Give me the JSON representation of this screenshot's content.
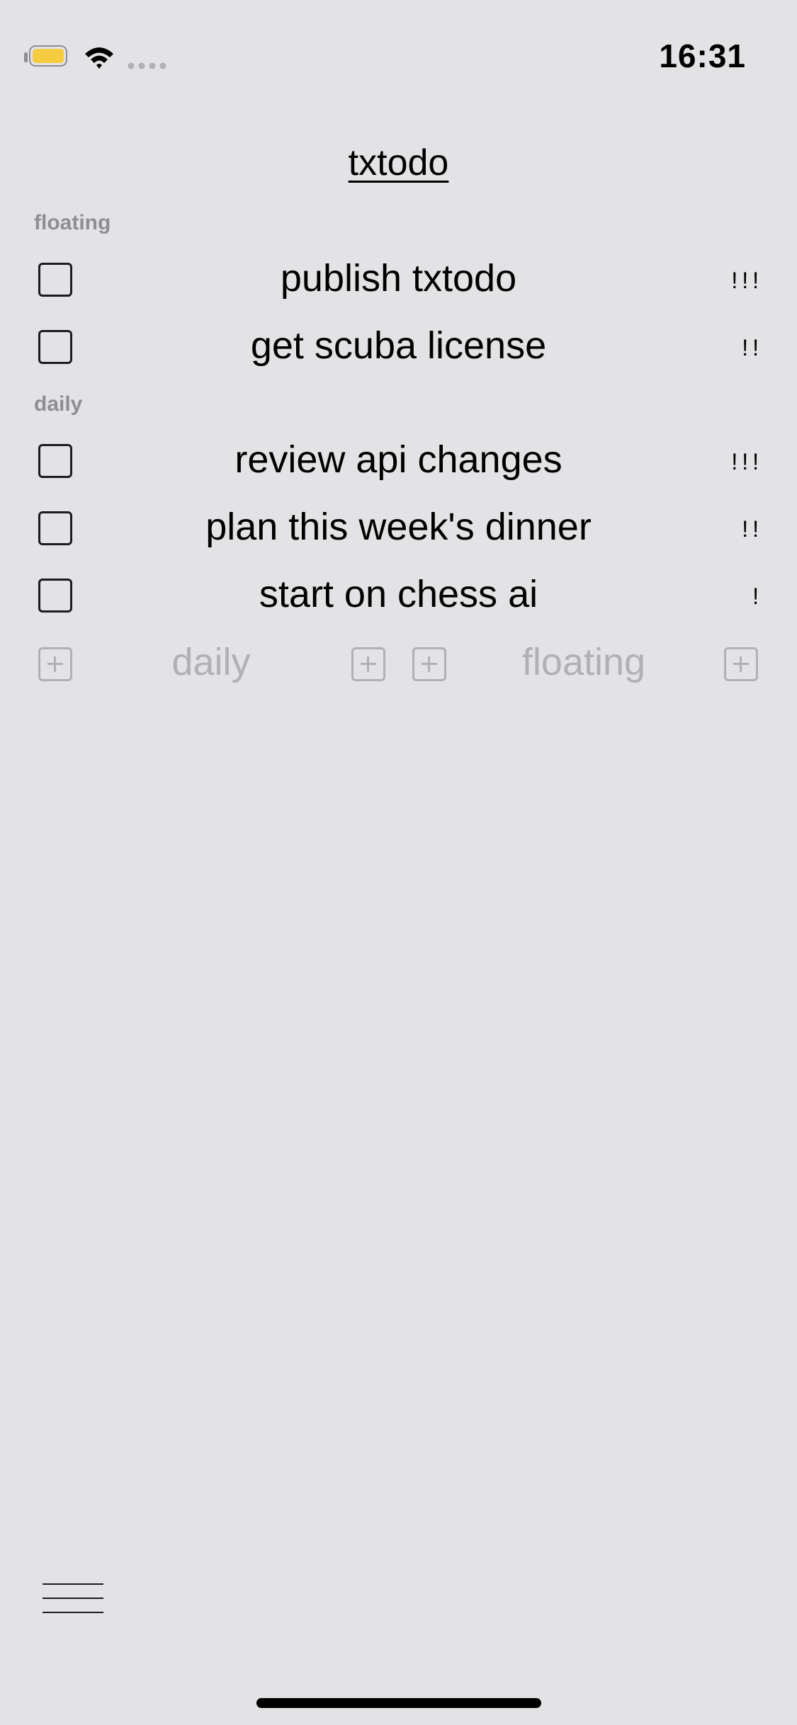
{
  "status_bar": {
    "time": "16:31",
    "battery_color": "#f5cc40"
  },
  "header": {
    "title": "txtodo"
  },
  "sections": [
    {
      "label": "floating",
      "tasks": [
        {
          "text": "publish txtodo",
          "priority": "!!!",
          "checked": false
        },
        {
          "text": "get scuba license",
          "priority": "!!",
          "checked": false
        }
      ]
    },
    {
      "label": "daily",
      "tasks": [
        {
          "text": "review api changes",
          "priority": "!!!",
          "checked": false
        },
        {
          "text": "plan this week's dinner",
          "priority": "!!",
          "checked": false
        },
        {
          "text": "start on chess ai",
          "priority": "!",
          "checked": false
        }
      ]
    }
  ],
  "add_bar": {
    "daily_label": "daily",
    "floating_label": "floating"
  },
  "icons": {
    "menu": "hamburger-menu-icon",
    "add": "plus-square-icon",
    "checkbox": "empty-checkbox-icon"
  }
}
